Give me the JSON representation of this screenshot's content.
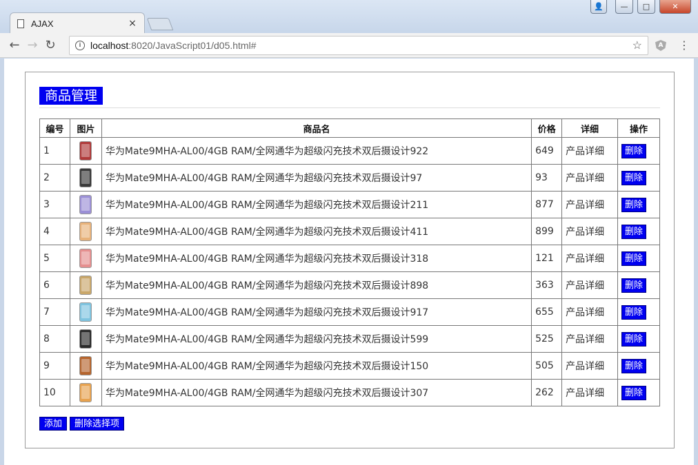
{
  "browser": {
    "tab_title": "AJAX",
    "tab_close": "×",
    "url_host": "localhost",
    "url_path": ":8020/JavaScript01/d05.html#",
    "window_buttons": {
      "user": "👤",
      "minimize": "—",
      "maximize": "□",
      "close": "✕"
    }
  },
  "page": {
    "heading": "商品管理",
    "table": {
      "headers": [
        "编号",
        "图片",
        "商品名",
        "价格",
        "详细",
        "操作"
      ],
      "rows": [
        {
          "id": "1",
          "name": "华为Mate9MHA-AL00/4GB RAM/全网通华为超级闪充技术双后摄设计922",
          "price": "649",
          "detail": "产品详细",
          "action": "删除",
          "phone_color": "#b03a3a"
        },
        {
          "id": "2",
          "name": "华为Mate9MHA-AL00/4GB RAM/全网通华为超级闪充技术双后摄设计97",
          "price": "93",
          "detail": "产品详细",
          "action": "删除",
          "phone_color": "#3a3a3a"
        },
        {
          "id": "3",
          "name": "华为Mate9MHA-AL00/4GB RAM/全网通华为超级闪充技术双后摄设计211",
          "price": "877",
          "detail": "产品详细",
          "action": "删除",
          "phone_color": "#9b8fd6"
        },
        {
          "id": "4",
          "name": "华为Mate9MHA-AL00/4GB RAM/全网通华为超级闪充技术双后摄设计411",
          "price": "899",
          "detail": "产品详细",
          "action": "删除",
          "phone_color": "#e8b27a"
        },
        {
          "id": "5",
          "name": "华为Mate9MHA-AL00/4GB RAM/全网通华为超级闪充技术双后摄设计318",
          "price": "121",
          "detail": "产品详细",
          "action": "删除",
          "phone_color": "#e58f8f"
        },
        {
          "id": "6",
          "name": "华为Mate9MHA-AL00/4GB RAM/全网通华为超级闪充技术双后摄设计898",
          "price": "363",
          "detail": "产品详细",
          "action": "删除",
          "phone_color": "#c9a76a"
        },
        {
          "id": "7",
          "name": "华为Mate9MHA-AL00/4GB RAM/全网通华为超级闪充技术双后摄设计917",
          "price": "655",
          "detail": "产品详细",
          "action": "删除",
          "phone_color": "#7fc4e0"
        },
        {
          "id": "8",
          "name": "华为Mate9MHA-AL00/4GB RAM/全网通华为超级闪充技术双后摄设计599",
          "price": "525",
          "detail": "产品详细",
          "action": "删除",
          "phone_color": "#2a2a2a"
        },
        {
          "id": "9",
          "name": "华为Mate9MHA-AL00/4GB RAM/全网通华为超级闪充技术双后摄设计150",
          "price": "505",
          "detail": "产品详细",
          "action": "删除",
          "phone_color": "#b5652e"
        },
        {
          "id": "10",
          "name": "华为Mate9MHA-AL00/4GB RAM/全网通华为超级闪充技术双后摄设计307",
          "price": "262",
          "detail": "产品详细",
          "action": "删除",
          "phone_color": "#e7a24f"
        }
      ]
    },
    "buttons": {
      "add": "添加",
      "delete_selected": "删除选择项"
    }
  },
  "colors": {
    "accent": "#0000f0"
  }
}
